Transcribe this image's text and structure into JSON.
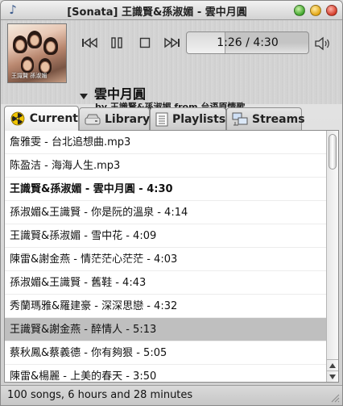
{
  "window": {
    "title": "[Sonata] 王識賢&孫淑媚 - 雲中月圓"
  },
  "player": {
    "elapsed_time": "1:26",
    "separator": " / ",
    "total_time": "4:30",
    "progress_fraction": 0.318,
    "album_art_caption": "王識賢 孫淑媚"
  },
  "now_playing": {
    "title": "雲中月圓",
    "by_label": "by",
    "artist": "王識賢&孫淑媚",
    "from_label": "from",
    "album": "台语原情歌"
  },
  "tabs": [
    {
      "label": "Current",
      "icon": "radiation-icon",
      "active": true
    },
    {
      "label": "Library",
      "icon": "disk-drive-icon",
      "active": false
    },
    {
      "label": "Playlists",
      "icon": "list-document-icon",
      "active": false
    },
    {
      "label": "Streams",
      "icon": "network-icon",
      "active": false
    }
  ],
  "playlist": [
    "詹雅雯 - 台北追想曲.mp3",
    "陈盈洁 - 海海人生.mp3",
    "王識賢&孫淑媚 - 雲中月圓 - 4:30",
    "孫淑媚&王識賢 - 你是阮的溫泉 - 4:14",
    "王識賢&孫淑媚 - 雪中花 - 4:09",
    "陳雷&謝金燕 - 情茫茫心茫茫 - 4:03",
    "孫淑媚&王識賢 - 舊鞋 - 4:43",
    "秀蘭瑪雅&羅建豪 - 深深思戀 - 4:32",
    "王識賢&謝金燕 - 醉情人 - 5:13",
    "蔡秋鳳&蔡義德 - 你有夠狠 - 5:05",
    "陳雷&楊麗 - 上美的春天 - 3:50"
  ],
  "playing_index": 2,
  "selected_index": 8,
  "status": {
    "text": "100 songs, 6 hours and 28 minutes"
  },
  "colors": {
    "selected_row": "#bfbfbf",
    "accent_icon": "#e8b400"
  }
}
